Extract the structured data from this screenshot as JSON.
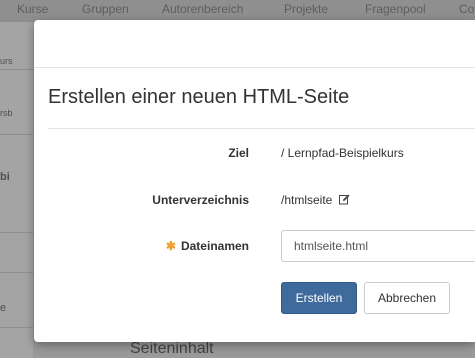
{
  "background": {
    "nav_items": [
      "Kurse",
      "Gruppen",
      "Autorenbereich",
      "Projekte",
      "Fragenpool",
      "Co"
    ],
    "side_fragments": [
      "urs",
      "rsb",
      "bi",
      "e"
    ],
    "bottom_heading": "Seiteninhalt"
  },
  "modal": {
    "title": "Erstellen einer neuen HTML-Seite",
    "fields": {
      "ziel_label": "Ziel",
      "ziel_value": "/ Lernpfad-Beispielkurs",
      "unterverzeichnis_label": "Unterverzeichnis",
      "unterverzeichnis_value": "/htmlseite",
      "dateinamen_label": "Dateinamen",
      "dateinamen_value": "htmlseite.html",
      "required_marker": "✱"
    },
    "buttons": {
      "create": "Erstellen",
      "cancel": "Abbrechen"
    }
  },
  "colors": {
    "primary": "#3e6b9c",
    "required": "#f0a030"
  },
  "icons": {
    "edit": "edit-icon"
  }
}
